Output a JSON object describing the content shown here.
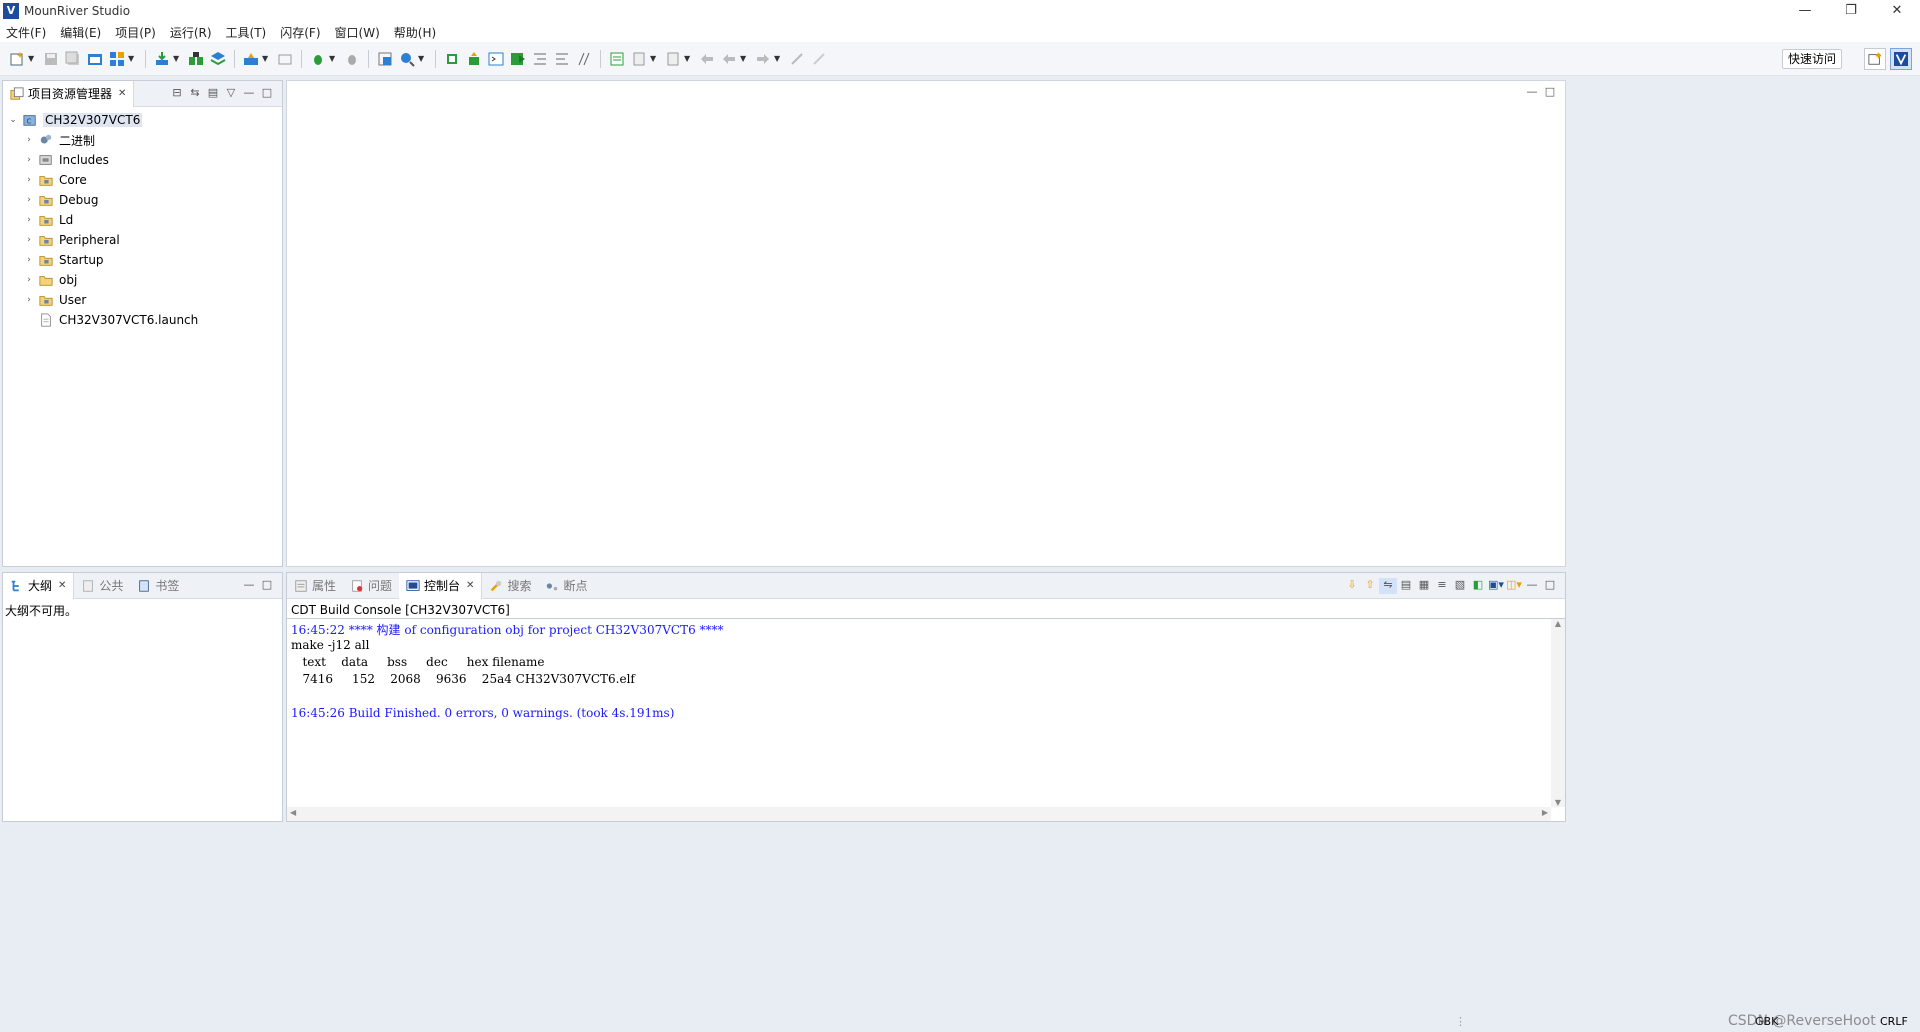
{
  "window": {
    "title": "MounRiver Studio",
    "controls": [
      "—",
      "❐",
      "✕"
    ]
  },
  "menu": [
    "文件(F)",
    "编辑(E)",
    "项目(P)",
    "运行(R)",
    "工具(T)",
    "闪存(F)",
    "窗口(W)",
    "帮助(H)"
  ],
  "toolbar": {
    "quick_access": "快速访问"
  },
  "project_explorer": {
    "tab_label": "项目资源管理器",
    "root": "CH32V307VCT6",
    "items": [
      {
        "label": "二进制",
        "icon": "binary-icon"
      },
      {
        "label": "Includes",
        "icon": "includes-icon"
      },
      {
        "label": "Core",
        "icon": "source-folder-icon"
      },
      {
        "label": "Debug",
        "icon": "source-folder-icon"
      },
      {
        "label": "Ld",
        "icon": "source-folder-icon"
      },
      {
        "label": "Peripheral",
        "icon": "source-folder-icon"
      },
      {
        "label": "Startup",
        "icon": "source-folder-icon"
      },
      {
        "label": "obj",
        "icon": "folder-icon"
      },
      {
        "label": "User",
        "icon": "source-folder-icon"
      }
    ],
    "launch_file": "CH32V307VCT6.launch"
  },
  "outline": {
    "tabs": {
      "outline": "大纲",
      "common": "公共",
      "bookmarks": "书签"
    },
    "message": "大纲不可用。"
  },
  "bottom": {
    "tabs": {
      "properties": "属性",
      "problems": "问题",
      "console": "控制台",
      "search": "搜索",
      "breakpoints": "断点"
    },
    "console_title": "CDT Build Console [CH32V307VCT6]",
    "lines": {
      "l1_time": "16:45:22 **** ",
      "l1_build": "构建",
      "l1_rest": " of configuration obj for project CH32V307VCT6 ****",
      "l2": "make -j12 all",
      "l3": "   text    data     bss     dec     hex filename",
      "l4": "   7416     152    2068    9636    25a4 CH32V307VCT6.elf",
      "l6": "16:45:26 Build Finished. 0 errors, 0 warnings. (took 4s.191ms)"
    }
  },
  "status": {
    "encoding": "GBK",
    "line_ending": "CRLF",
    "watermark": "CSDN @ReverseHoot"
  },
  "colors": {
    "console_blue": "#1a1aff",
    "accent": "#1b4d9c"
  }
}
